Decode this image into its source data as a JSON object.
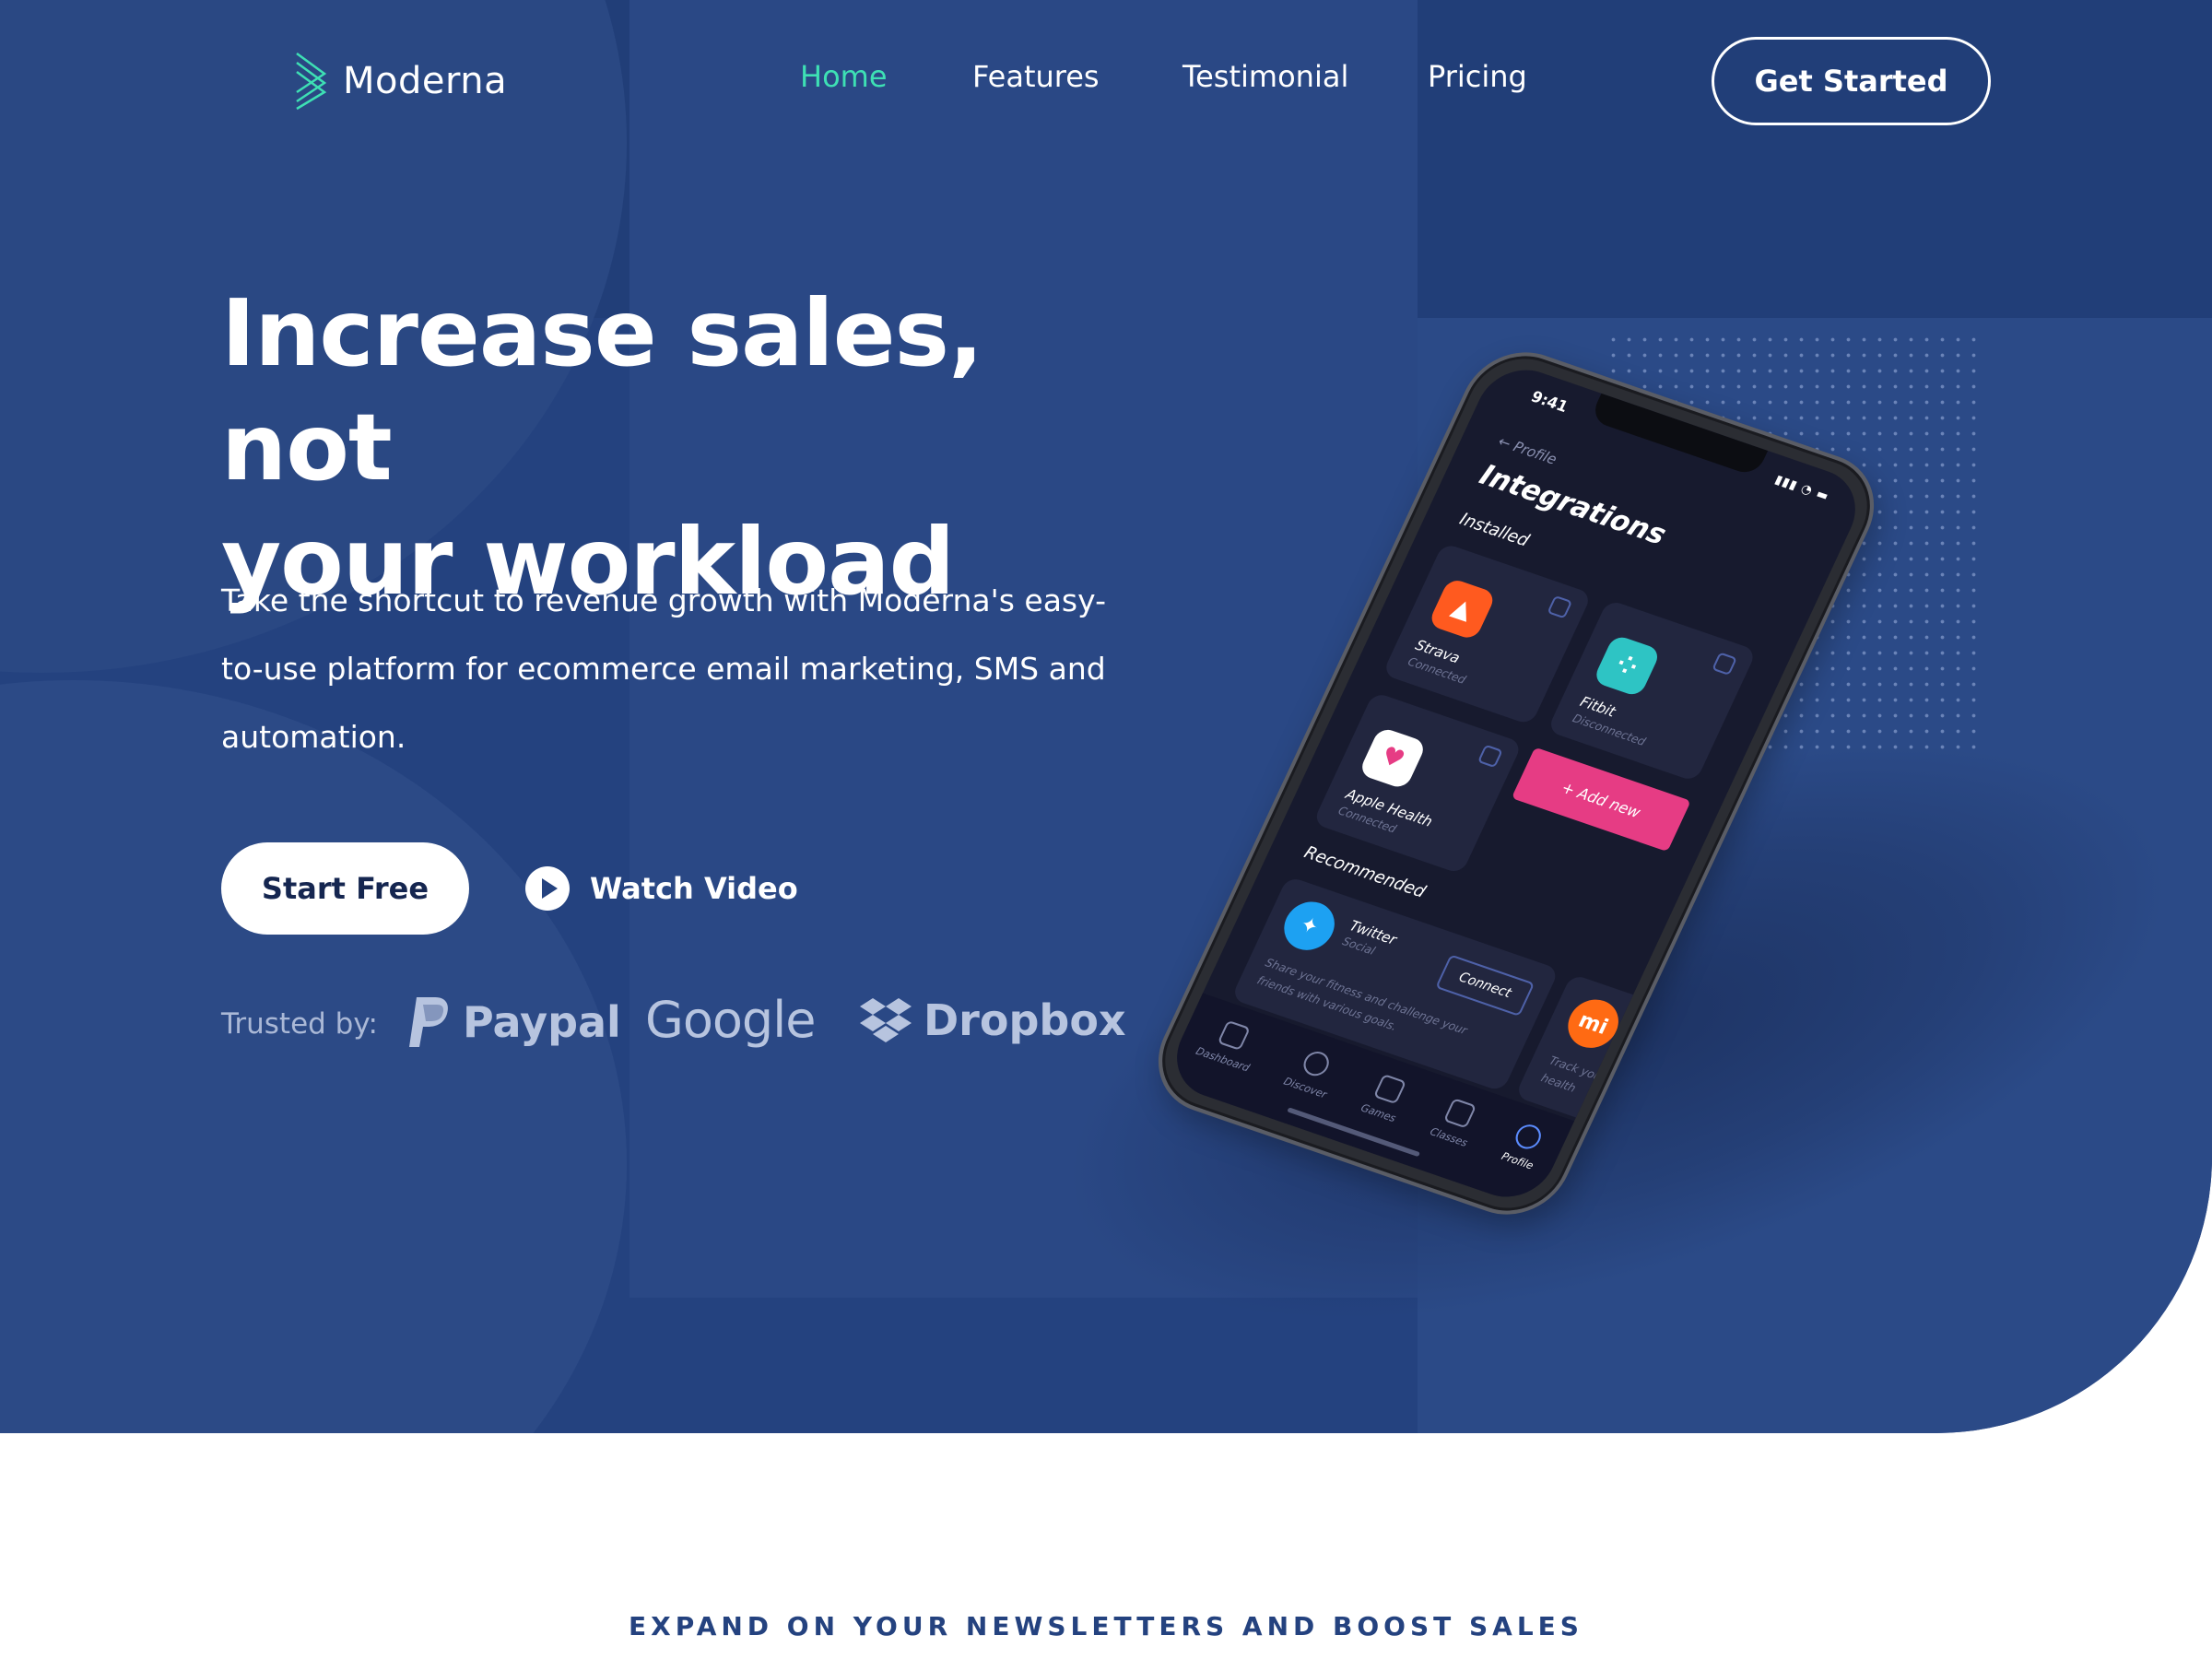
{
  "colors": {
    "hero_bg": "#24427f",
    "accent": "#3ee0b4",
    "text_on_dark": "#ffffff",
    "muted_brand": "#b7c4df",
    "button_text": "#152650",
    "add_new_pink": "#e63c84"
  },
  "header": {
    "brand": "Moderna",
    "logo_icon": "chevron-stack-icon",
    "nav": [
      {
        "label": "Home",
        "active": true
      },
      {
        "label": "Features",
        "active": false
      },
      {
        "label": "Testimonial",
        "active": false
      },
      {
        "label": "Pricing",
        "active": false
      }
    ],
    "cta": "Get Started"
  },
  "hero": {
    "headline_line1": "Increase sales, not",
    "headline_line2": "your workload",
    "subtext": "Take the shortcut to revenue growth with Moderna's easy-to-use platform for ecommerce email marketing, SMS and automation.",
    "primary_button": "Start Free",
    "video_link": "Watch Video",
    "video_icon": "play-circle-icon"
  },
  "trusted": {
    "label": "Trusted by:",
    "brands": [
      {
        "name": "Paypal",
        "icon": "paypal-icon"
      },
      {
        "name": "Google",
        "icon": "google-wordmark"
      },
      {
        "name": "Dropbox",
        "icon": "dropbox-icon"
      }
    ]
  },
  "phone": {
    "time": "9:41",
    "back_label": "Profile",
    "title": "Integrations",
    "installed_heading": "Installed",
    "installed": [
      {
        "name": "Strava",
        "status": "Connected",
        "icon": "strava-icon",
        "color": "#ff5a1f"
      },
      {
        "name": "Fitbit",
        "status": "Disconnected",
        "icon": "fitbit-icon",
        "color": "#2ec4c4"
      },
      {
        "name": "Apple Health",
        "status": "Connected",
        "icon": "heart-icon",
        "color": "#ffffff"
      }
    ],
    "add_new": "+ Add new",
    "recommended_heading": "Recommended",
    "recommended": [
      {
        "name": "Twitter",
        "sub": "Social",
        "desc": "Share your fitness and challenge your friends with various goals.",
        "action": "Connect",
        "icon": "twitter-icon",
        "color": "#1da1f2"
      },
      {
        "name": "M",
        "sub": "",
        "desc": "Track your your health",
        "icon": "mi-icon",
        "color": "#ff6a13"
      }
    ],
    "tabs": [
      {
        "label": "Dashboard",
        "icon": "dashboard-icon"
      },
      {
        "label": "Discover",
        "icon": "compass-icon"
      },
      {
        "label": "Games",
        "icon": "trophy-icon"
      },
      {
        "label": "Classes",
        "icon": "calendar-icon"
      },
      {
        "label": "Profile",
        "icon": "user-icon",
        "active": true
      }
    ]
  },
  "section2": {
    "eyebrow": "EXPAND ON YOUR NEWSLETTERS AND BOOST SALES"
  }
}
